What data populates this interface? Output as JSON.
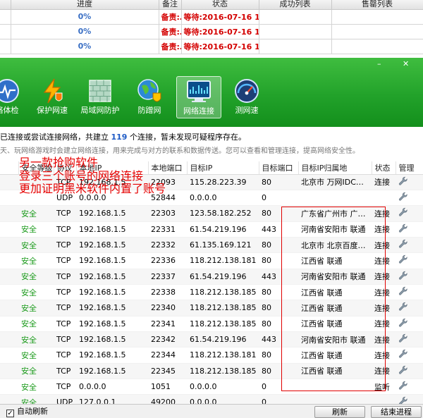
{
  "task_table": {
    "headers": [
      "进度",
      "备注",
      "状态",
      "成功列表",
      "售罄列表"
    ],
    "rows": [
      {
        "progress": "0%",
        "note": "备责:…",
        "status": "等待:2016-07-16 11:…"
      },
      {
        "progress": "0%",
        "note": "备责:…",
        "status": "等待:2016-07-16 11:…"
      },
      {
        "progress": "0%",
        "note": "备责:…",
        "status": "等待:2016-07-16 11:…"
      }
    ]
  },
  "window_buttons": {
    "minimize": "–",
    "close": "✕"
  },
  "toolbar": {
    "items": [
      {
        "label": "络体检",
        "icon": "gauge-icon"
      },
      {
        "label": "保护网速",
        "icon": "lightning-shield-icon"
      },
      {
        "label": "局域网防护",
        "icon": "firewall-icon"
      },
      {
        "label": "防蹭网",
        "icon": "globe-shield-icon"
      },
      {
        "label": "网络连接",
        "icon": "monitor-chart-icon",
        "active": true
      },
      {
        "label": "测网速",
        "icon": "speedometer-icon"
      }
    ]
  },
  "info": {
    "line1_prefix": "已连接或尝试连接网络，共建立",
    "line1_count": "119",
    "line1_suffix": "个连接，暂未发现可疑程序存在。",
    "line2": "天、玩网络游戏时会建立网络连接，用来完成与对方的联系和数据传送。您可以查看和管理连接，提高网络安全性。"
  },
  "conn_table": {
    "headers": [
      "安全等级",
      "协议",
      "本地IP",
      "本地端口",
      "目标IP",
      "目标端口",
      "目标IP归属地",
      "状态",
      "管理"
    ],
    "rows": [
      {
        "safety": "",
        "proto": "TCP",
        "local_ip": "192.168.1.5",
        "local_port": "22093",
        "remote_ip": "115.28.223.39",
        "remote_port": "80",
        "location": "北京市 万网IDC…",
        "state": "连接"
      },
      {
        "safety": "",
        "proto": "UDP",
        "local_ip": "0.0.0.0",
        "local_port": "52844",
        "remote_ip": "0.0.0.0",
        "remote_port": "0",
        "location": "",
        "state": ""
      },
      {
        "safety": "安全",
        "proto": "TCP",
        "local_ip": "192.168.1.5",
        "local_port": "22303",
        "remote_ip": "123.58.182.252",
        "remote_port": "80",
        "location": "广东省广州市 广…",
        "state": "连接"
      },
      {
        "safety": "安全",
        "proto": "TCP",
        "local_ip": "192.168.1.5",
        "local_port": "22331",
        "remote_ip": "61.54.219.196",
        "remote_port": "443",
        "location": "河南省安阳市 联通",
        "state": "连接"
      },
      {
        "safety": "安全",
        "proto": "TCP",
        "local_ip": "192.168.1.5",
        "local_port": "22332",
        "remote_ip": "61.135.169.121",
        "remote_port": "80",
        "location": "北京市 北京百度…",
        "state": "连接"
      },
      {
        "safety": "安全",
        "proto": "TCP",
        "local_ip": "192.168.1.5",
        "local_port": "22336",
        "remote_ip": "118.212.138.181",
        "remote_port": "80",
        "location": "江西省 联通",
        "state": "连接"
      },
      {
        "safety": "安全",
        "proto": "TCP",
        "local_ip": "192.168.1.5",
        "local_port": "22337",
        "remote_ip": "61.54.219.196",
        "remote_port": "443",
        "location": "河南省安阳市 联通",
        "state": "连接"
      },
      {
        "safety": "安全",
        "proto": "TCP",
        "local_ip": "192.168.1.5",
        "local_port": "22338",
        "remote_ip": "118.212.138.185",
        "remote_port": "80",
        "location": "江西省 联通",
        "state": "连接"
      },
      {
        "safety": "安全",
        "proto": "TCP",
        "local_ip": "192.168.1.5",
        "local_port": "22340",
        "remote_ip": "118.212.138.185",
        "remote_port": "80",
        "location": "江西省 联通",
        "state": "连接"
      },
      {
        "safety": "安全",
        "proto": "TCP",
        "local_ip": "192.168.1.5",
        "local_port": "22341",
        "remote_ip": "118.212.138.185",
        "remote_port": "80",
        "location": "江西省 联通",
        "state": "连接"
      },
      {
        "safety": "安全",
        "proto": "TCP",
        "local_ip": "192.168.1.5",
        "local_port": "22342",
        "remote_ip": "61.54.219.196",
        "remote_port": "443",
        "location": "河南省安阳市 联通",
        "state": "连接"
      },
      {
        "safety": "安全",
        "proto": "TCP",
        "local_ip": "192.168.1.5",
        "local_port": "22344",
        "remote_ip": "118.212.138.181",
        "remote_port": "80",
        "location": "江西省 联通",
        "state": "连接"
      },
      {
        "safety": "安全",
        "proto": "TCP",
        "local_ip": "192.168.1.5",
        "local_port": "22345",
        "remote_ip": "118.212.138.185",
        "remote_port": "80",
        "location": "江西省 联通",
        "state": "连接"
      },
      {
        "safety": "安全",
        "proto": "TCP",
        "local_ip": "0.0.0.0",
        "local_port": "1051",
        "remote_ip": "0.0.0.0",
        "remote_port": "0",
        "location": "",
        "state": "监听"
      },
      {
        "safety": "安全",
        "proto": "UDP",
        "local_ip": "127.0.0.1",
        "local_port": "49200",
        "remote_ip": "0.0.0.0",
        "remote_port": "0",
        "location": "",
        "state": ""
      }
    ]
  },
  "annotation": {
    "lines": [
      "另一款抢购软件",
      "登录三个账号的网络连接",
      "更加证明黑米软件内置了账号"
    ]
  },
  "bottom": {
    "auto_refresh_label": "自动刷新",
    "refresh_label": "刷新",
    "end_process_label": "结束进程"
  },
  "colors": {
    "toolbar_green": "#22a22a",
    "safe_green": "#1a9a1a",
    "annotation_red": "#e60000",
    "count_blue": "#1e5bc6"
  }
}
